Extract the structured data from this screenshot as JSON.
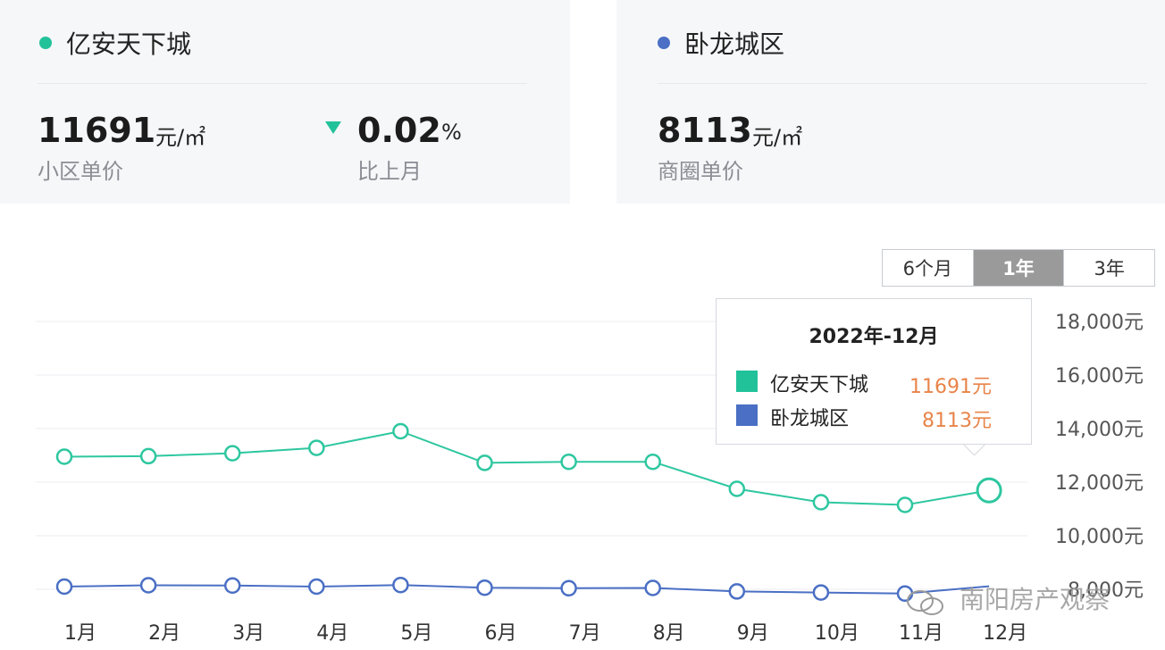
{
  "summary": {
    "community": {
      "name": "亿安天下城",
      "dot_color": "#21c29a",
      "price": "11691",
      "unit": "元/㎡",
      "price_label": "小区单价",
      "change": "0.02",
      "change_unit": "%",
      "change_label": "比上月",
      "change_direction": "down"
    },
    "district": {
      "name": "卧龙城区",
      "dot_color": "#4a6fc4",
      "price": "8113",
      "unit": "元/㎡",
      "price_label": "商圈单价"
    }
  },
  "range_tabs": [
    {
      "label": "6个月",
      "active": false
    },
    {
      "label": "1年",
      "active": true
    },
    {
      "label": "3年",
      "active": false
    }
  ],
  "tooltip": {
    "title": "2022年-12月",
    "rows": [
      {
        "name": "亿安天下城",
        "value": "11691元",
        "color": "#21c29a"
      },
      {
        "name": "卧龙城区",
        "value": "8113元",
        "color": "#4a6fc4"
      }
    ]
  },
  "watermark": "南阳房产观察",
  "chart_data": {
    "type": "line",
    "categories": [
      "1月",
      "2月",
      "3月",
      "4月",
      "5月",
      "6月",
      "7月",
      "8月",
      "9月",
      "10月",
      "11月",
      "12月"
    ],
    "y_tick_labels": [
      "8,000元",
      "10,000元",
      "12,000元",
      "14,000元",
      "16,000元",
      "18,000元"
    ],
    "y_ticks": [
      8000,
      10000,
      12000,
      14000,
      16000,
      18000
    ],
    "ylim": [
      7400,
      18000
    ],
    "grid": true,
    "series": [
      {
        "name": "亿安天下城",
        "color": "#2ec7a0",
        "values": [
          12950,
          12970,
          13080,
          13280,
          13900,
          12720,
          12760,
          12760,
          11750,
          11250,
          11150,
          11691
        ]
      },
      {
        "name": "卧龙城区",
        "color": "#4a6fc4",
        "values": [
          8100,
          8150,
          8140,
          8100,
          8160,
          8060,
          8040,
          8050,
          7920,
          7880,
          7840,
          8113
        ]
      }
    ]
  }
}
